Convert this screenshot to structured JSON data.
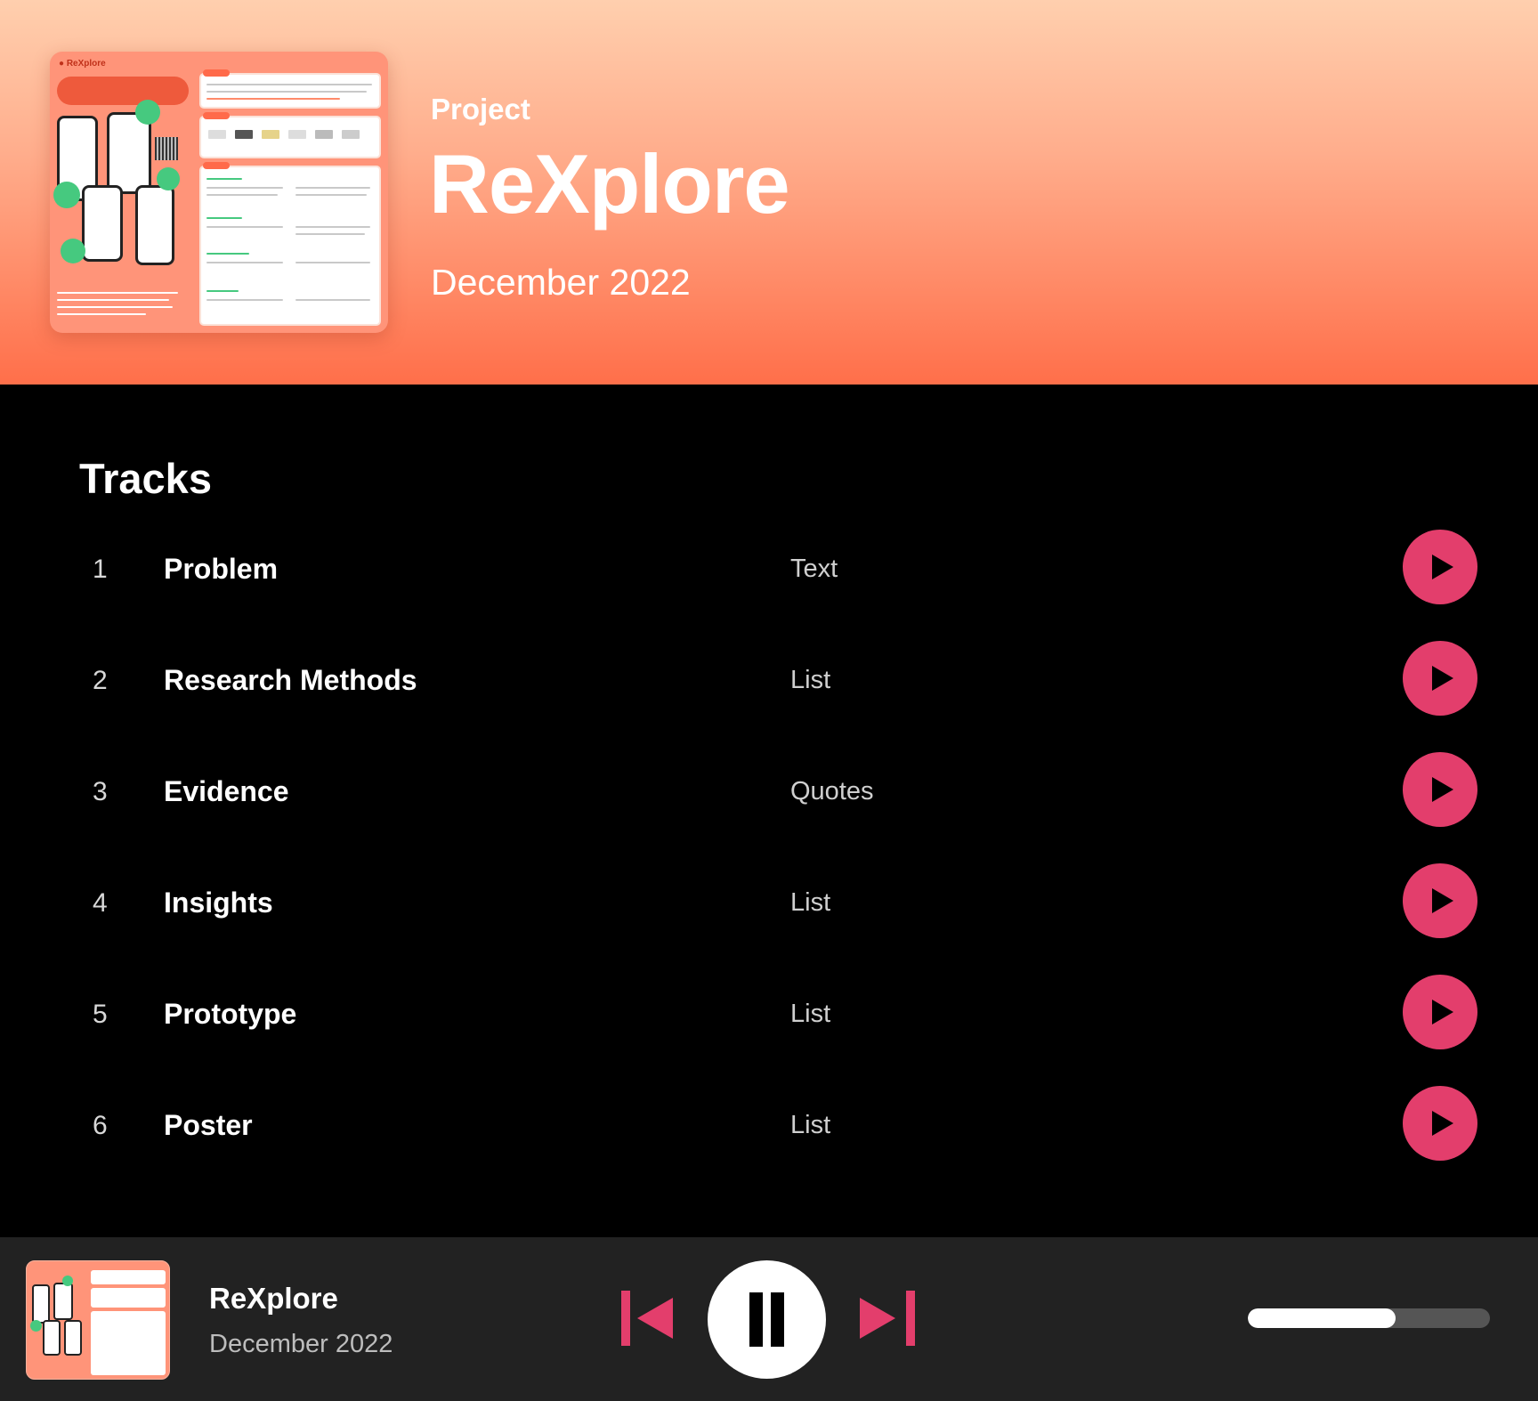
{
  "header": {
    "cover_art": "project-poster",
    "label": "Project",
    "title": "ReXplore",
    "date": "December 2022"
  },
  "tracks": {
    "heading": "Tracks",
    "items": [
      {
        "number": "1",
        "title": "Problem",
        "type": "Text"
      },
      {
        "number": "2",
        "title": "Research Methods",
        "type": "List"
      },
      {
        "number": "3",
        "title": "Evidence",
        "type": "Quotes"
      },
      {
        "number": "4",
        "title": "Insights",
        "type": "List"
      },
      {
        "number": "5",
        "title": "Prototype",
        "type": "List"
      },
      {
        "number": "6",
        "title": "Poster",
        "type": "List"
      }
    ]
  },
  "player": {
    "now_playing_title": "ReXplore",
    "now_playing_date": "December 2022",
    "progress": 0.61,
    "icons": [
      "skip-previous-icon",
      "pause-icon",
      "skip-next-icon",
      "play-icon"
    ]
  },
  "colors": {
    "accent": "#e33e6c",
    "header_top": "#ffcfae",
    "header_bottom": "#ff6f4a",
    "background": "#000000",
    "player_bar": "#222222"
  }
}
